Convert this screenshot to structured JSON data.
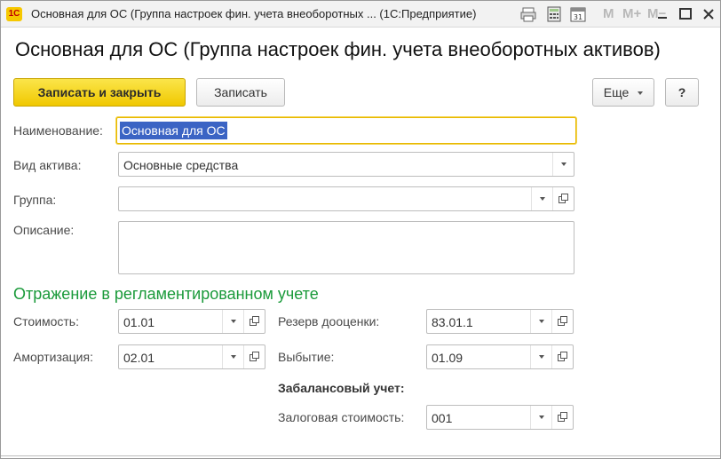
{
  "window": {
    "title": "Основная для ОС (Группа настроек фин. учета внеоборотных ... (1С:Предприятие)",
    "logo": "1С",
    "toolbar_icons": [
      "print-icon",
      "calculator-icon",
      "calendar-icon"
    ],
    "memory_labels": [
      "M",
      "M+",
      "M−"
    ],
    "controls": [
      "minimize-icon",
      "maximize-icon",
      "close-icon"
    ]
  },
  "form": {
    "title": "Основная для ОС (Группа настроек фин. учета внеоборотных активов)",
    "buttons": {
      "save_close": "Записать и закрыть",
      "save": "Записать",
      "more": "Еще",
      "help": "?"
    },
    "fields": {
      "name": {
        "label": "Наименование:",
        "value": "Основная для ОС"
      },
      "asset_kind": {
        "label": "Вид актива:",
        "value": "Основные средства"
      },
      "group": {
        "label": "Группа:",
        "value": ""
      },
      "description": {
        "label": "Описание:",
        "value": ""
      }
    }
  },
  "reflection": {
    "title": "Отражение в регламентированном учете",
    "cost": {
      "label": "Стоимость:",
      "value": "01.01"
    },
    "amortization": {
      "label": "Амортизация:",
      "value": "02.01"
    },
    "revaluation_reserve": {
      "label": "Резерв дооценки:",
      "value": "83.01.1"
    },
    "disposal": {
      "label": "Выбытие:",
      "value": "01.09"
    },
    "offbalance_title": "Забалансовый учет:",
    "pledge_value": {
      "label": "Залоговая стоимость:",
      "value": "001"
    }
  },
  "colors": {
    "accent_yellow": "#f0c800",
    "section_green": "#1a9a3a",
    "selection_blue": "#3b64c4"
  }
}
